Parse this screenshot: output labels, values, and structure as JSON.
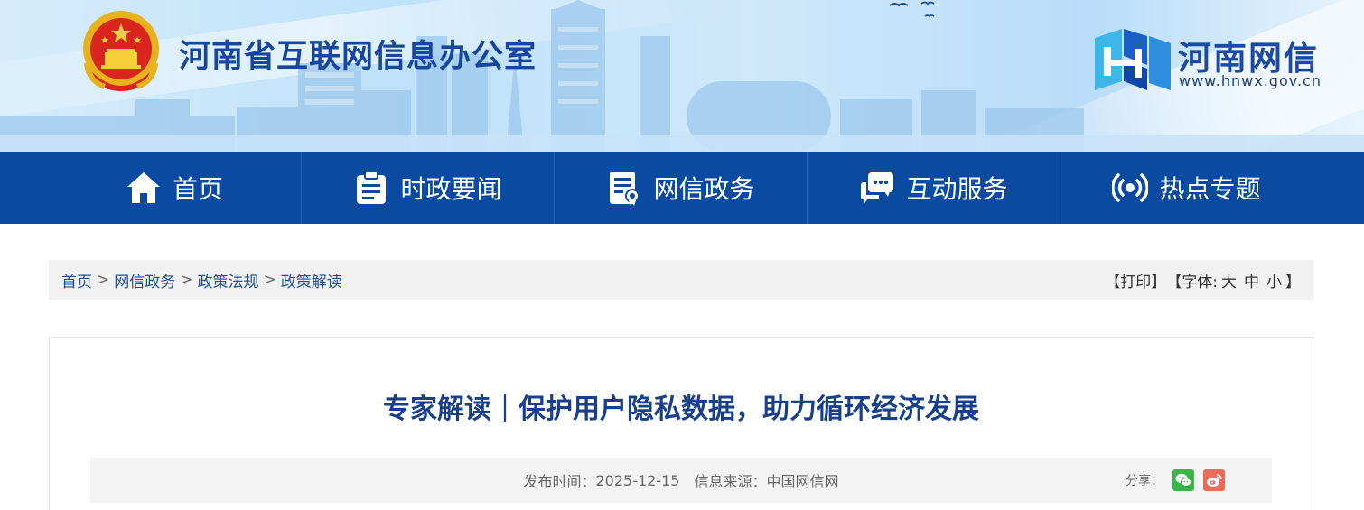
{
  "header": {
    "site_title": "河南省互联网信息办公室",
    "logo_text": "河南网信",
    "logo_url": "www.hnwx.gov.cn",
    "emblem_icon": "national-emblem-icon",
    "colors": {
      "title": "#1746a0",
      "nav_bg": "#0a4aa1"
    }
  },
  "nav": {
    "items": [
      {
        "label": "首页",
        "icon": "home-icon"
      },
      {
        "label": "时政要闻",
        "icon": "clipboard-icon"
      },
      {
        "label": "网信政务",
        "icon": "document-badge-icon"
      },
      {
        "label": "互动服务",
        "icon": "chat-bubbles-icon"
      },
      {
        "label": "热点专题",
        "icon": "broadcast-icon"
      }
    ]
  },
  "breadcrumb": {
    "items": [
      "首页",
      "网信政务",
      "政策法规",
      "政策解读"
    ],
    "separator": ">"
  },
  "tools": {
    "print": "【打印】",
    "font_prefix": "【字体:",
    "font_large": "大",
    "font_medium": "中",
    "font_small": "小",
    "font_suffix": "】"
  },
  "article": {
    "title": "专家解读｜保护用户隐私数据，助力循环经济发展",
    "publish_label": "发布时间：",
    "publish_date": "2025-12-15",
    "source_label": "信息来源：",
    "source": "中国网信网",
    "share_label": "分享："
  }
}
